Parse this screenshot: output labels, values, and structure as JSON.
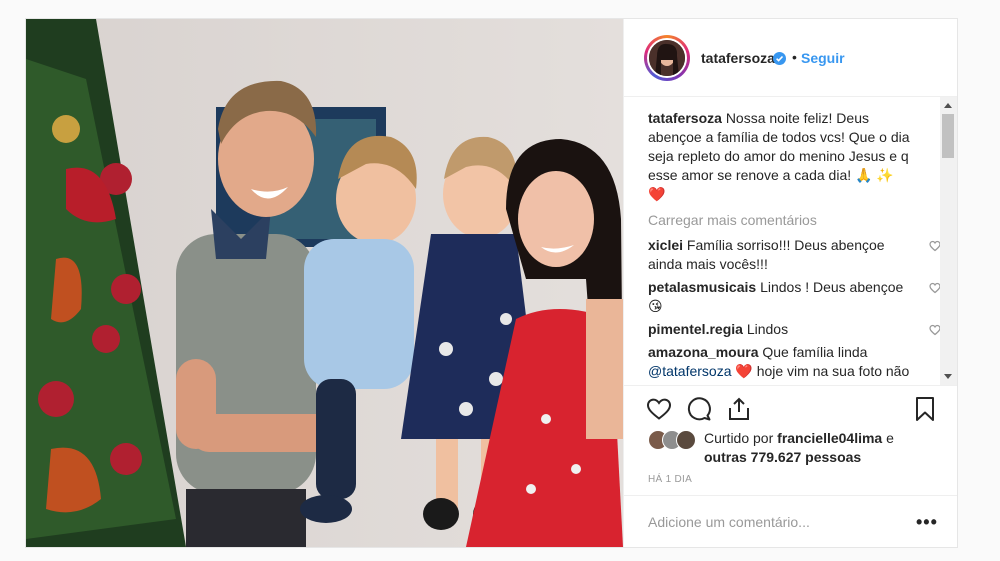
{
  "post": {
    "username": "tatafersoza",
    "follow_label": "Seguir",
    "separator": "•",
    "caption": "Nossa noite feliz! Deus abençoe a família de todos vcs! Que o dia seja repleto do amor do menino Jesus e q esse amor se renove a cada dia! 🙏 ✨ ❤️",
    "load_more": "Carregar mais comentários",
    "comments": [
      {
        "user": "xiclei",
        "text": "Família sorriso!!! Deus abençoe ainda mais vocês!!!"
      },
      {
        "user": "petalasmusicais",
        "text": "Lindos ! Deus abençoe 😘"
      },
      {
        "user": "pimentel.regia",
        "text": "Lindos"
      },
      {
        "user": "amazona_moura",
        "text": "Que família linda",
        "mention": "@tatafersoza",
        "text2": "❤️ hoje vim na sua foto não somente para elogiar a família linda que você tem mas também"
      }
    ],
    "likes_prefix": "Curtido por",
    "likes_user": "francielle04lima",
    "likes_and": "e",
    "likes_others": "outras 779.627 pessoas",
    "time_ago": "HÁ 1 DIA",
    "add_comment_placeholder": "Adicione um comentário...",
    "more_options": "•••"
  },
  "icons": [
    "verified-badge-icon",
    "heart-icon",
    "comment-icon",
    "share-icon",
    "bookmark-icon",
    "more-options-icon"
  ],
  "colors": {
    "link": "#3897f0",
    "text": "#262626",
    "muted": "#999999",
    "heart_red": "#ed4956"
  }
}
